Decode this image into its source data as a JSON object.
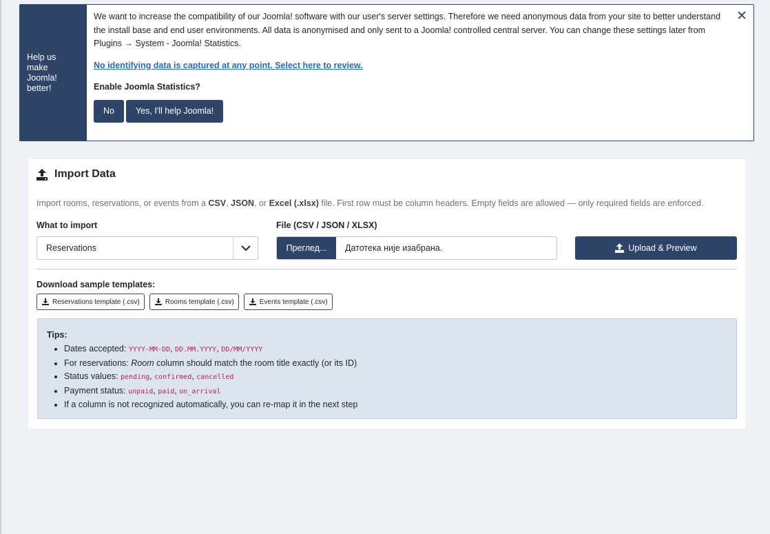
{
  "stats": {
    "side_label": "Help us make Joomla! better!",
    "message": "We want to increase the compatibility of our Joomla! software with our user's server settings. Therefore we need anonymous data from your site to better understand the install base and end user environments. All data is anonymised and only sent to a Joomla! controlled central server. You can change these settings later from Plugins → System - Joomla! Statistics.",
    "review_link": "No identifying data is captured at any point. Select here to review.",
    "question": "Enable Joomla Statistics?",
    "no_label": "No",
    "yes_label": "Yes, I'll help Joomla!",
    "close_glyph": "✕"
  },
  "import": {
    "title": "Import Data",
    "desc_prefix": "Import rooms, reservations, or events from a ",
    "fmt_csv": "CSV",
    "sep1": ", ",
    "fmt_json": "JSON",
    "sep2": ", or ",
    "fmt_excel": "Excel (.xlsx)",
    "desc_suffix": " file. First row must be column headers. Empty fields are allowed — only required fields are enforced.",
    "what_label": "What to import",
    "what_value": "Reservations",
    "file_label": "File (CSV / JSON / XLSX)",
    "browse_label": "Прeглед...",
    "file_status": "Датотека није изабрана.",
    "upload_label": "Upload & Preview",
    "templates_label": "Download sample templates:",
    "templates": [
      "Reservations template (.csv)",
      "Rooms template (.csv)",
      "Events template (.csv)"
    ]
  },
  "tips": {
    "title": "Tips:",
    "dates_prefix": "Dates accepted: ",
    "date_formats": [
      "YYYY-MM-DD",
      "DD.MM.YYYY",
      "DD/MM/YYYY"
    ],
    "res_prefix": "For reservations: ",
    "res_room": "Room",
    "res_suffix": " column should match the room title exactly (or its ID)",
    "status_prefix": "Status values: ",
    "status_values": [
      "pending",
      "confirmed",
      "cancelled"
    ],
    "payment_prefix": "Payment status: ",
    "payment_values": [
      "unpaid",
      "paid",
      "on_arrival"
    ],
    "remap": "If a column is not recognized automatically, you can re-map it in the next step",
    "comma": ","
  }
}
